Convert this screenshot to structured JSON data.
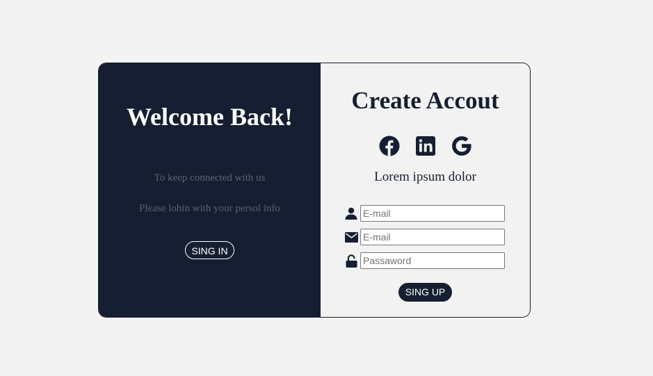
{
  "left_panel": {
    "title": "Welcome Back!",
    "line1": "To keep connected with us",
    "line2": "Please lohin with your persol info",
    "signin_label": "SING IN"
  },
  "right_panel": {
    "title": "Create Accout",
    "socials": [
      "facebook-icon",
      "linkedin-icon",
      "google-icon"
    ],
    "subtitle": "Lorem ipsum dolor",
    "fields": [
      {
        "icon": "user-icon",
        "placeholder": "E-mail",
        "value": ""
      },
      {
        "icon": "envelope-icon",
        "placeholder": "E-mail",
        "value": ""
      },
      {
        "icon": "unlock-icon",
        "placeholder": "Passaword",
        "value": ""
      }
    ],
    "signup_label": "SING UP"
  },
  "colors": {
    "page_bg": "#f3f3f3",
    "dark_navy": "#151f31",
    "panel_light": "#f2f2f2",
    "muted_text": "#5a6270",
    "white": "#ffffff"
  }
}
